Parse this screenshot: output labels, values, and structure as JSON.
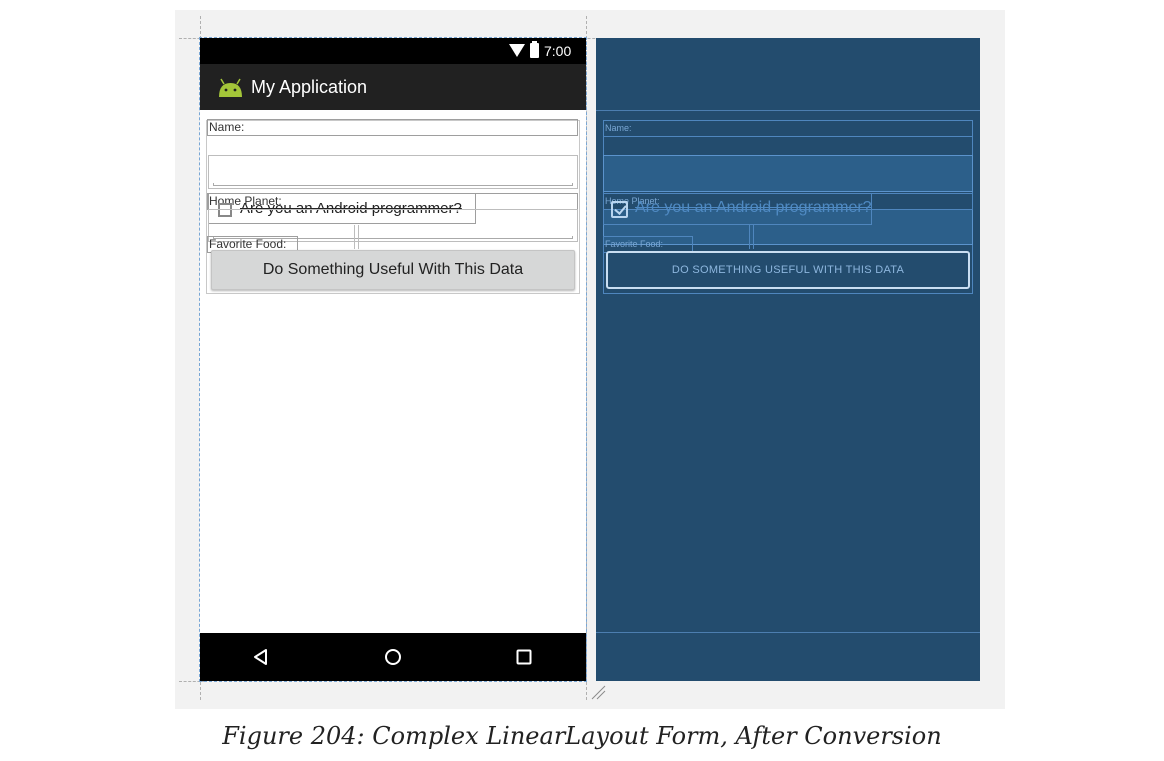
{
  "app": {
    "title": "My Application",
    "time": "7:00"
  },
  "design": {
    "name_label": "Name:",
    "home_planet_label": "Home Planet:",
    "favorite_food_label": "Favorite Food:",
    "checkbox_label": "Are you an Android programmer?",
    "button_label": "Do Something Useful With This Data"
  },
  "blueprint": {
    "name_label": "Name:",
    "home_planet_label": "Home Planet:",
    "favorite_food_label": "Favorite Food:",
    "checkbox_label": "Are you an Android programmer?",
    "checkbox_checked": true,
    "button_label": "DO SOMETHING USEFUL WITH THIS DATA"
  },
  "nav": {
    "back_icon": "back-triangle-icon",
    "home_icon": "home-circle-icon",
    "recents_icon": "recents-square-icon"
  },
  "colors": {
    "blueprint_bg": "#234c6e",
    "android_green": "#a4c639"
  },
  "caption": "Figure 204: Complex LinearLayout Form, After Conversion"
}
